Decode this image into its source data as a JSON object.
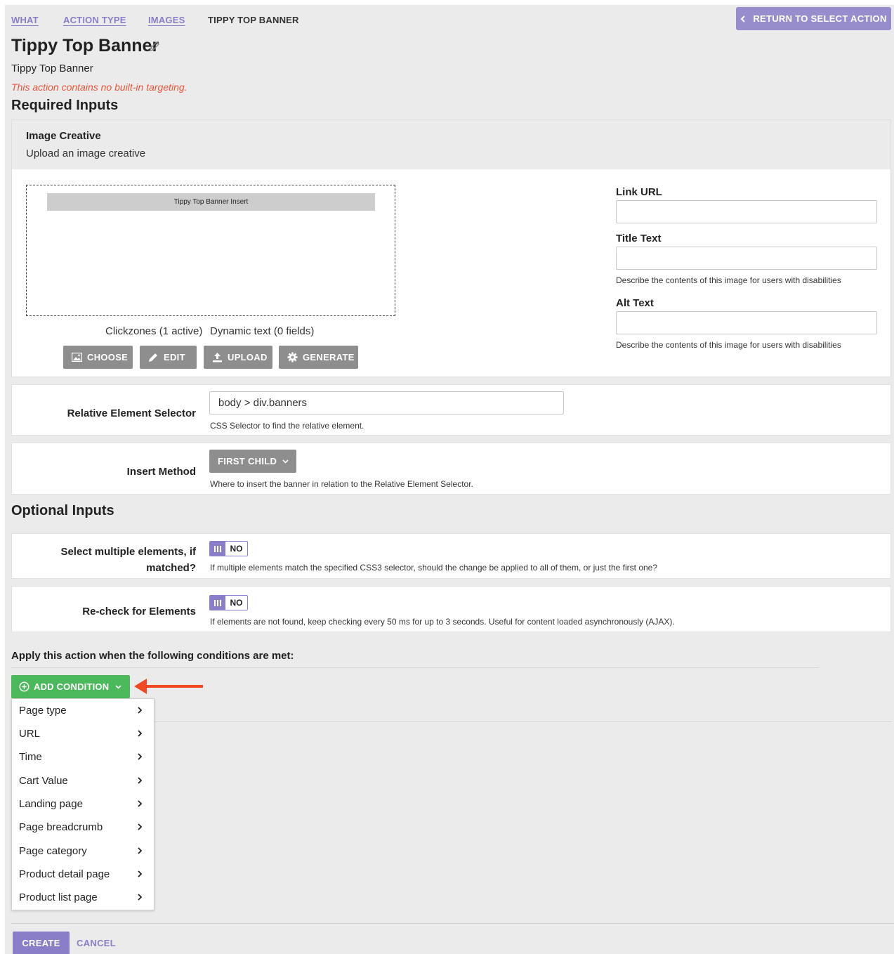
{
  "breadcrumb": {
    "items": [
      "WHAT",
      "ACTION TYPE",
      "IMAGES"
    ],
    "current": "TIPPY TOP BANNER"
  },
  "header": {
    "return_button": "RETURN TO SELECT ACTION",
    "title": "Tippy Top Banner",
    "subtitle": "Tippy Top Banner",
    "warning": "This action contains no built-in targeting."
  },
  "required_inputs": {
    "heading": "Required Inputs",
    "image_creative": {
      "title": "Image Creative",
      "description": "Upload an image creative",
      "banner_text": "Tippy Top Banner Insert",
      "clickzones": "Clickzones (1 active)",
      "dynamic_text": "Dynamic text (0 fields)",
      "buttons": [
        "CHOOSE",
        "EDIT",
        "UPLOAD",
        "GENERATE"
      ],
      "link_url": {
        "label": "Link URL",
        "value": ""
      },
      "title_text": {
        "label": "Title Text",
        "value": "",
        "help": "Describe the contents of this image for users with disabilities"
      },
      "alt_text": {
        "label": "Alt Text",
        "value": "",
        "help": "Describe the contents of this image for users with disabilities"
      }
    },
    "relative_selector": {
      "label": "Relative Element Selector",
      "value": "body > div.banners",
      "help": "CSS Selector to find the relative element."
    },
    "insert_method": {
      "label": "Insert Method",
      "value": "FIRST CHILD",
      "help": "Where to insert the banner in relation to the Relative Element Selector."
    }
  },
  "optional_inputs": {
    "heading": "Optional Inputs",
    "select_multiple": {
      "label_line1": "Select multiple elements, if",
      "label_line2": "matched?",
      "value": "NO",
      "help": "If multiple elements match the specified CSS3 selector, should the change be applied to all of them, or just the first one?"
    },
    "recheck": {
      "label": "Re-check for Elements",
      "value": "NO",
      "help": "If elements are not found, keep checking every 50 ms for up to 3 seconds. Useful for content loaded asynchronously (AJAX)."
    }
  },
  "conditions": {
    "title": "Apply this action when the following conditions are met:",
    "add_button": "ADD CONDITION",
    "menu": [
      "Page type",
      "URL",
      "Time",
      "Cart Value",
      "Landing page",
      "Page breadcrumb",
      "Page category",
      "Product detail page",
      "Product list page"
    ]
  },
  "footer": {
    "create": "CREATE",
    "cancel": "CANCEL"
  },
  "colors": {
    "accent": "#978dcc",
    "link": "#8b7ec8",
    "warning": "#e8553a",
    "success": "#4cb85c",
    "arrow": "#f04a25"
  }
}
